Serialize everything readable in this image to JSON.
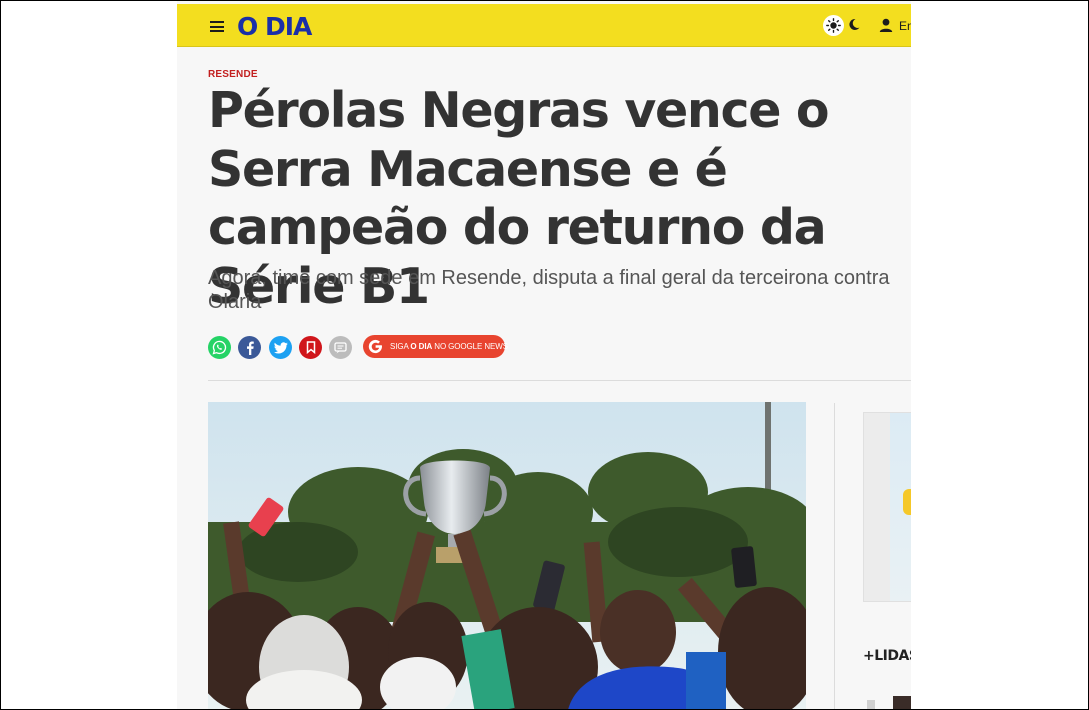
{
  "header": {
    "logo": "O DIA",
    "login_label": "En",
    "brand_color": "#f3de1f",
    "logo_color": "#1a2fa8"
  },
  "article": {
    "category": "RESENDE",
    "title": "Pérolas Negras vence o Serra Macaense e é campeão do returno da Série B1",
    "subtitle": "Agora, time com sede em Resende, disputa a final geral da terceirona contra Olaria",
    "category_color": "#c21f1f"
  },
  "share": {
    "icons": [
      "whatsapp-icon",
      "facebook-icon",
      "twitter-icon",
      "bookmark-icon",
      "comments-icon"
    ],
    "google_news": {
      "prefix": "SIGA ",
      "brand": "O DIA",
      "suffix": " NO GOOGLE NEWS"
    }
  },
  "sidebar": {
    "most_read_label": "+LIDAS"
  }
}
